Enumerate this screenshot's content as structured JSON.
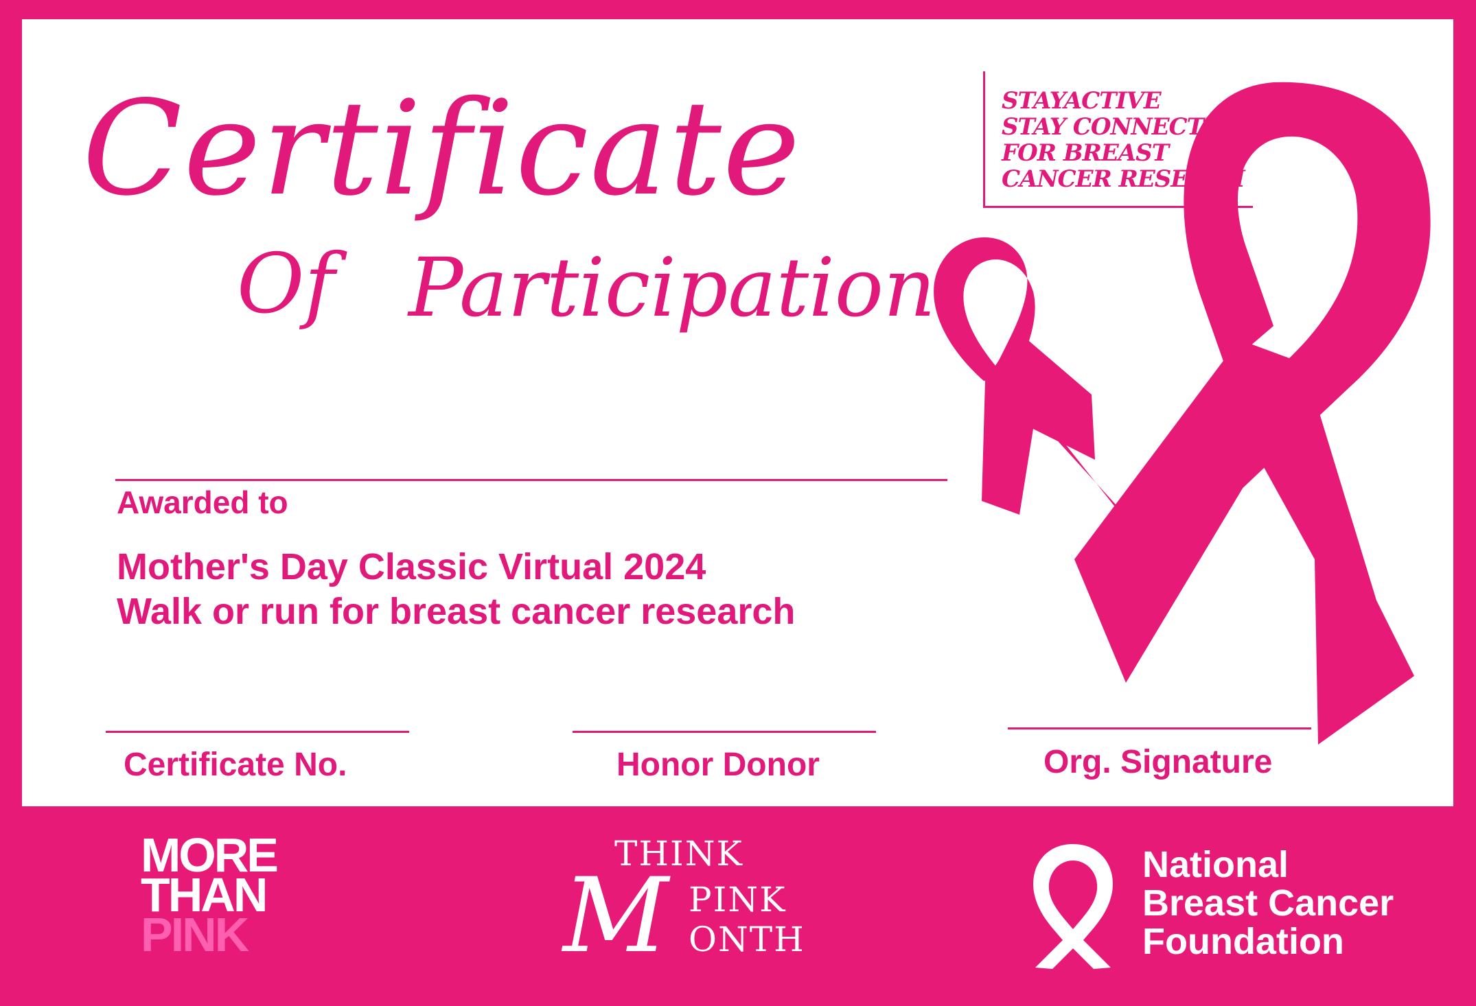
{
  "certificate": {
    "title_main": "Certificate",
    "title_of": "Of",
    "title_participation": "Participation",
    "slogan_lines": [
      "STAYACTIVE",
      "STAY CONNECTED",
      "FOR BREAST",
      "CANCER RESEACH"
    ],
    "awarded_label": "Awarded to",
    "event_line_1": "Mother's Day Classic Virtual 2024",
    "event_line_2": "Walk or run for breast cancer research",
    "certificate_no_label": "Certificate No.",
    "honor_donor_label": "Honor Donor",
    "org_signature_label": "Org. Signature"
  },
  "footer": {
    "more_than_pink": [
      "MORE",
      "THAN",
      "PINK"
    ],
    "think_pink_month": {
      "think": "THINK",
      "pink": "PINK",
      "onth": "ONTH",
      "m": "M"
    },
    "nbcf_lines": [
      "National",
      "Breast Cancer",
      "Foundation"
    ]
  },
  "colors": {
    "brand_pink": "#e81a78",
    "text_pink": "#e0197a",
    "light_pink": "#ff5fb0",
    "white": "#ffffff"
  },
  "icons": [
    "pink-ribbon-large-icon",
    "pink-ribbon-small-icon",
    "white-ribbon-icon"
  ]
}
